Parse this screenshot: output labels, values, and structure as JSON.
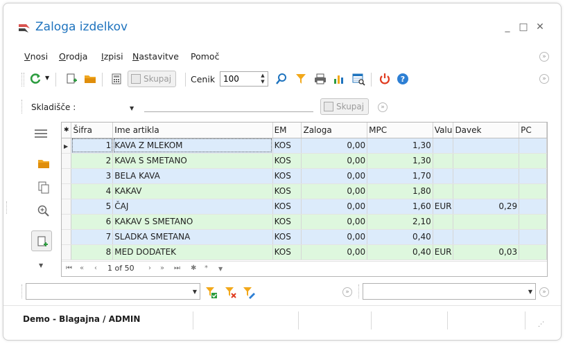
{
  "window": {
    "title": "Zaloga izdelkov",
    "minimize_glyph": "_",
    "maximize_glyph": "□",
    "close_glyph": "✕"
  },
  "menu": [
    {
      "label": "Vnosi",
      "accel": "V",
      "rest": "nosi"
    },
    {
      "label": "Orodja",
      "accel": "O",
      "rest": "rodja"
    },
    {
      "label": "Izpisi",
      "accel": "I",
      "rest": "zpisi"
    },
    {
      "label": "Nastavitve",
      "accel": "N",
      "rest": "astavitve"
    },
    {
      "label": "Pomoč",
      "accel": "",
      "rest": "Pomoč"
    }
  ],
  "toolbar": {
    "group_button_label": "Skupaj",
    "price_list_label": "Cenik",
    "price_list_value": "100"
  },
  "filter": {
    "warehouse_label": "Skladišče :",
    "warehouse_value": "",
    "group_button_label": "Skupaj"
  },
  "grid": {
    "columns": [
      "Šifra",
      "Ime artikla",
      "EM",
      "Zaloga",
      "MPC",
      "Valu",
      "Davek",
      "PC"
    ],
    "rows": [
      {
        "sifra": "1",
        "ime": "KAVA Z MLEKOM",
        "em": "KOS",
        "zaloga": "0,00",
        "mpc": "1,30",
        "valuta": "",
        "davek": "",
        "pc": "",
        "style": "blue"
      },
      {
        "sifra": "2",
        "ime": "KAVA S SMETANO",
        "em": "KOS",
        "zaloga": "0,00",
        "mpc": "1,30",
        "valuta": "",
        "davek": "",
        "pc": "",
        "style": "green"
      },
      {
        "sifra": "3",
        "ime": "BELA KAVA",
        "em": "KOS",
        "zaloga": "0,00",
        "mpc": "1,70",
        "valuta": "",
        "davek": "",
        "pc": "",
        "style": "blue"
      },
      {
        "sifra": "4",
        "ime": "KAKAV",
        "em": "KOS",
        "zaloga": "0,00",
        "mpc": "1,80",
        "valuta": "",
        "davek": "",
        "pc": "",
        "style": "green"
      },
      {
        "sifra": "5",
        "ime": "ČAJ",
        "em": "KOS",
        "zaloga": "0,00",
        "mpc": "1,60",
        "valuta": "EUR",
        "davek": "0,29",
        "pc": "",
        "style": "blue"
      },
      {
        "sifra": "6",
        "ime": "KAKAV S SMETANO",
        "em": "KOS",
        "zaloga": "0,00",
        "mpc": "2,10",
        "valuta": "",
        "davek": "",
        "pc": "",
        "style": "green"
      },
      {
        "sifra": "7",
        "ime": "SLADKA SMETANA",
        "em": "KOS",
        "zaloga": "0,00",
        "mpc": "0,40",
        "valuta": "",
        "davek": "",
        "pc": "",
        "style": "blue"
      },
      {
        "sifra": "8",
        "ime": "MED DODATEK",
        "em": "KOS",
        "zaloga": "0,00",
        "mpc": "0,40",
        "valuta": "EUR",
        "davek": "0,03",
        "pc": "",
        "style": "green"
      }
    ],
    "selected_row": 0,
    "navigator": {
      "first": "⏮",
      "prev_page": "«",
      "prev": "‹",
      "position": "1 of 50",
      "next": "›",
      "next_page": "»",
      "last": "⏭",
      "append": "✱",
      "edit": "*",
      "filter": "▼"
    }
  },
  "status": {
    "text": "Demo - Blagajna / ADMIN"
  },
  "colors": {
    "title": "#1e73be",
    "row_blue": "#dcebfb",
    "row_green": "#def7de",
    "close_red": "#e03a1e",
    "help_blue": "#2d7fd4"
  }
}
